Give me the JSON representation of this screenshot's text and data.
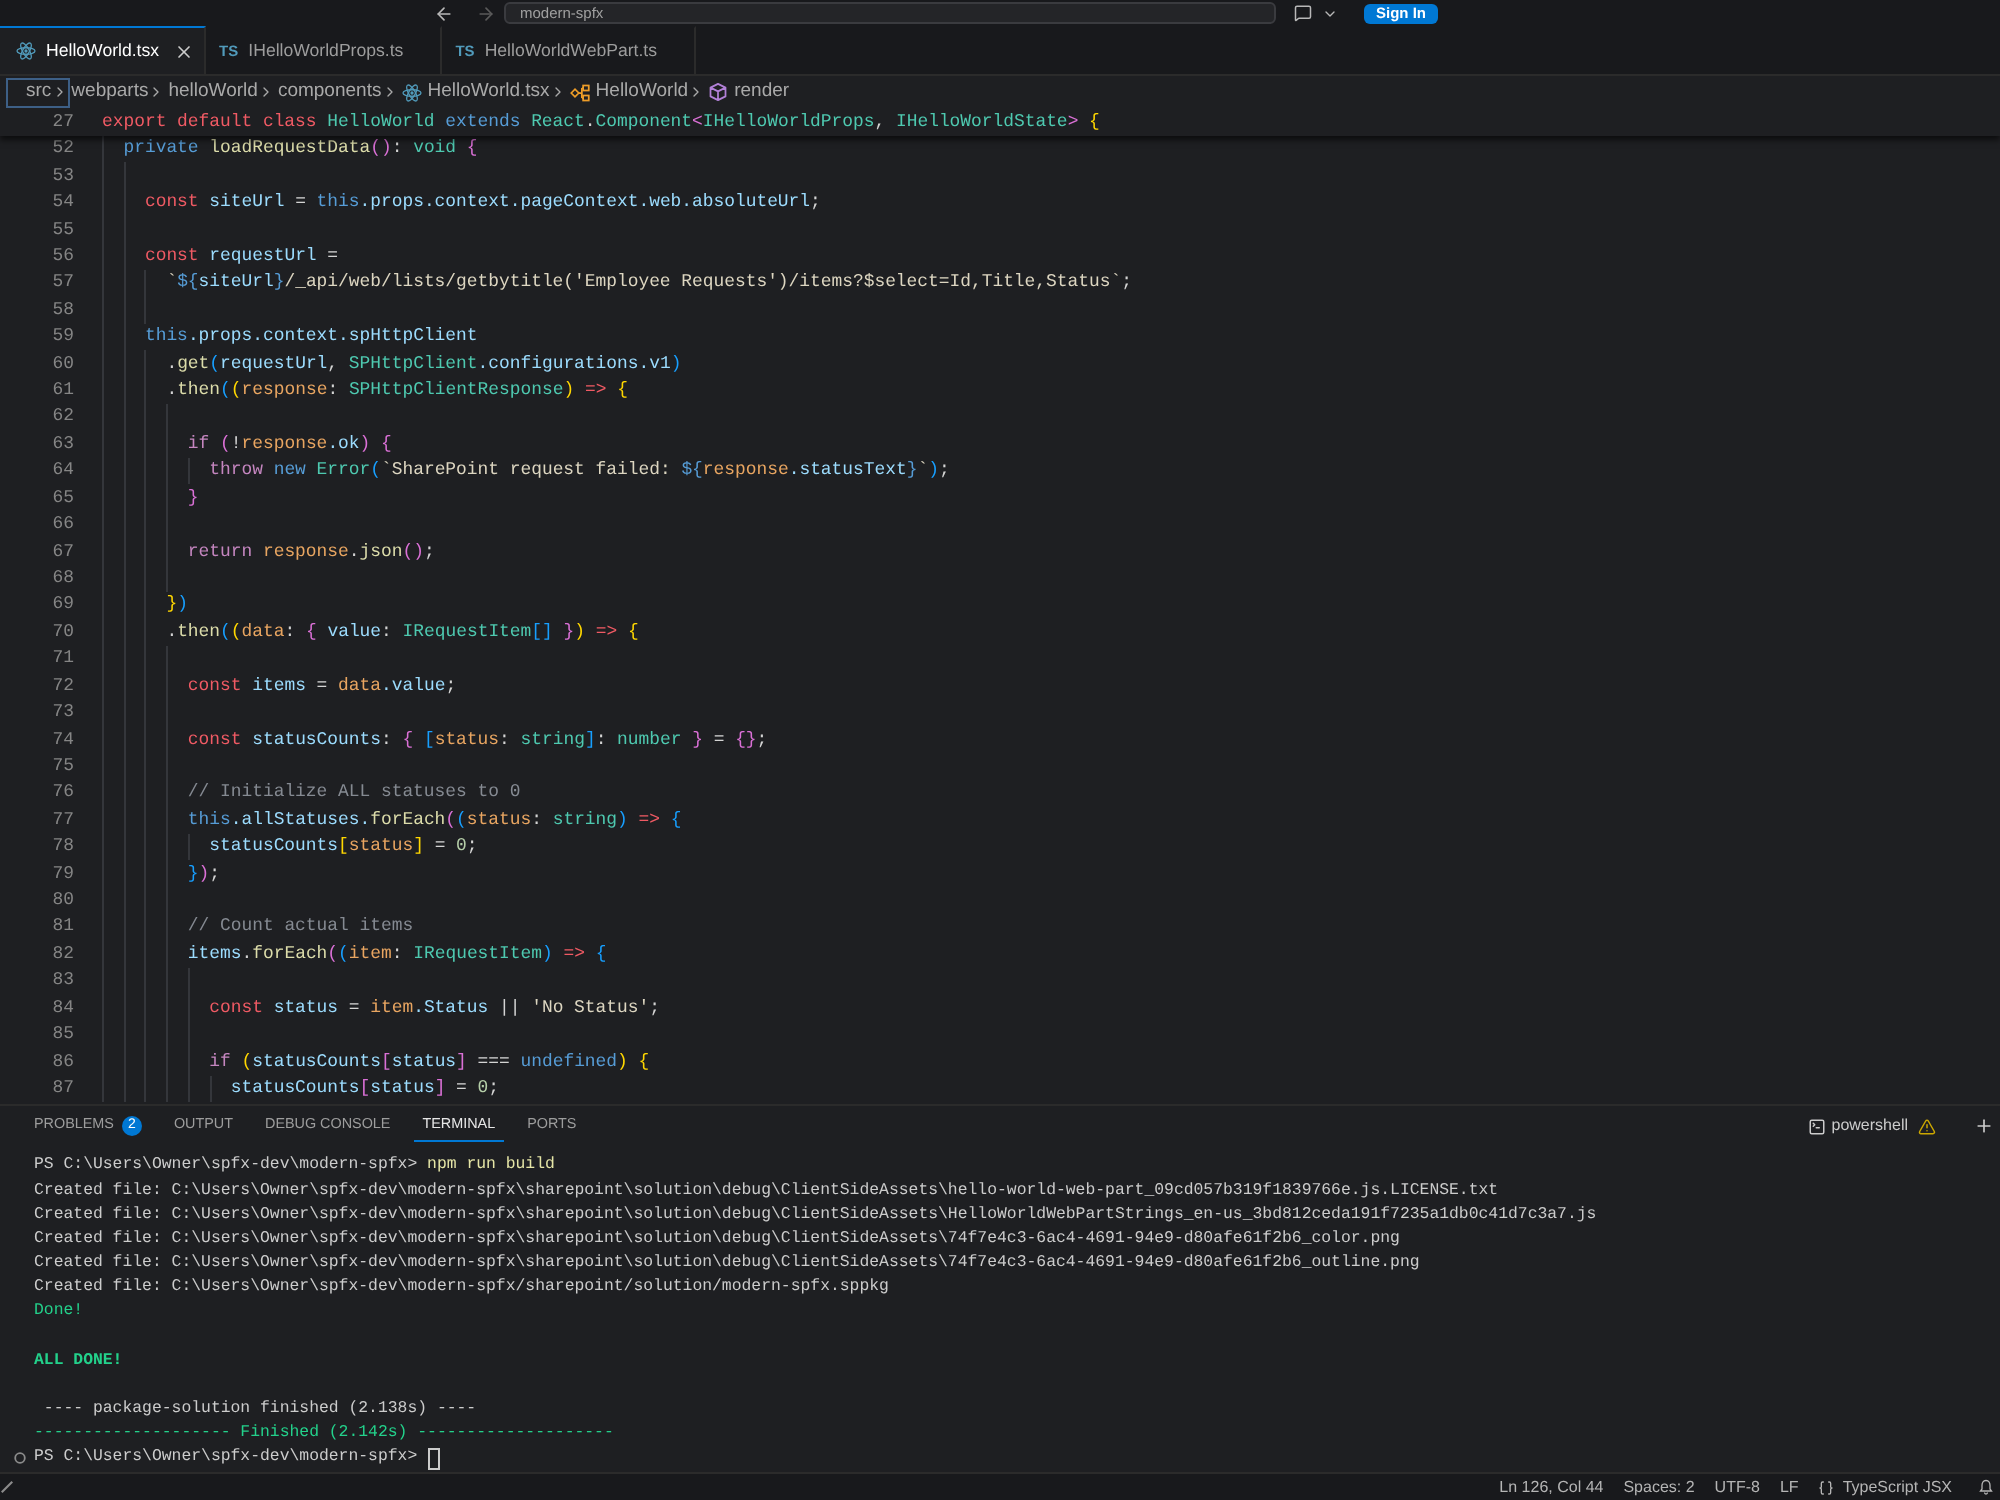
{
  "title_bar": {
    "back": {
      "disabled": false
    },
    "forward": {
      "disabled": true
    },
    "command_center": {
      "label": "modern-spfx"
    },
    "sign_in": {
      "label": "Sign In"
    }
  },
  "tabs": [
    {
      "label": "HelloWorld.tsx",
      "kind": "tsx",
      "selected": true
    },
    {
      "label": "IHelloWorldProps.ts",
      "kind": "ts",
      "file_badge": "TS",
      "selected": false
    },
    {
      "label": "HelloWorldWebPart.ts",
      "kind": "ts",
      "file_badge": "TS",
      "selected": false
    }
  ],
  "breadcrumbs": [
    {
      "label": "src",
      "kind": "folder",
      "focused": true
    },
    {
      "label": "webparts",
      "kind": "folder",
      "focused": false
    },
    {
      "label": "helloWorld",
      "kind": "folder",
      "focused": false
    },
    {
      "label": "components",
      "kind": "folder",
      "focused": false
    },
    {
      "label": "HelloWorld.tsx",
      "kind": "tsx_file",
      "focused": false
    },
    {
      "label": "HelloWorld",
      "kind": "class",
      "focused": false
    },
    {
      "label": "render",
      "kind": "method",
      "focused": false
    }
  ],
  "editor": {
    "sticky_line": {
      "number": "27",
      "tokens": [
        {
          "text": "export default class ",
          "kind": "decl"
        },
        {
          "text": "HelloWorld",
          "kind": "type"
        },
        {
          "text": " extends ",
          "kind": "kw"
        },
        {
          "text": "React",
          "kind": "type"
        },
        {
          "text": ".",
          "kind": "op"
        },
        {
          "text": "Component",
          "kind": "type"
        },
        {
          "text": "<",
          "kind": "b2"
        },
        {
          "text": "IHelloWorldProps",
          "kind": "type"
        },
        {
          "text": ", ",
          "kind": "op"
        },
        {
          "text": "IHelloWorldState",
          "kind": "type"
        },
        {
          "text": "> ",
          "kind": "b2"
        },
        {
          "text": "{",
          "kind": "b1"
        }
      ]
    },
    "lines": [
      {
        "number": "52",
        "tokens": [
          {
            "text": "  private ",
            "kind": "kw"
          },
          {
            "text": "loadRequestData",
            "kind": "fn"
          },
          {
            "text": "()",
            "kind": "b2"
          },
          {
            "text": ": ",
            "kind": "op"
          },
          {
            "text": "void ",
            "kind": "type"
          },
          {
            "text": "{",
            "kind": "b2"
          }
        ]
      },
      {
        "number": "53"
      },
      {
        "number": "54",
        "tokens": [
          {
            "text": "    const ",
            "kind": "decl"
          },
          {
            "text": "siteUrl",
            "kind": "var"
          },
          {
            "text": " = ",
            "kind": "op"
          },
          {
            "text": "this",
            "kind": "kw"
          },
          {
            "text": ".props.context.pageContext.web.absoluteUrl",
            "kind": "var"
          },
          {
            "text": ";",
            "kind": "op"
          }
        ]
      },
      {
        "number": "55"
      },
      {
        "number": "56",
        "tokens": [
          {
            "text": "    const ",
            "kind": "decl"
          },
          {
            "text": "requestUrl",
            "kind": "var"
          },
          {
            "text": " =",
            "kind": "op"
          }
        ]
      },
      {
        "number": "57",
        "tokens": [
          {
            "text": "      `",
            "kind": "str"
          },
          {
            "text": "${",
            "kind": "kw"
          },
          {
            "text": "siteUrl",
            "kind": "var"
          },
          {
            "text": "}",
            "kind": "kw"
          },
          {
            "text": "/_api/web/lists/getbytitle('Employee Requests')/items?$select=Id,Title,Status`",
            "kind": "str"
          },
          {
            "text": ";",
            "kind": "op"
          }
        ]
      },
      {
        "number": "58"
      },
      {
        "number": "59",
        "tokens": [
          {
            "text": "    this",
            "kind": "kw"
          },
          {
            "text": ".props.context.spHttpClient",
            "kind": "var"
          }
        ]
      },
      {
        "number": "60",
        "tokens": [
          {
            "text": "      .",
            "kind": "op"
          },
          {
            "text": "get",
            "kind": "fn"
          },
          {
            "text": "(",
            "kind": "b3"
          },
          {
            "text": "requestUrl",
            "kind": "var"
          },
          {
            "text": ", ",
            "kind": "op"
          },
          {
            "text": "SPHttpClient",
            "kind": "type"
          },
          {
            "text": ".configurations.v1",
            "kind": "var"
          },
          {
            "text": ")",
            "kind": "b3"
          }
        ]
      },
      {
        "number": "61",
        "tokens": [
          {
            "text": "      .",
            "kind": "op"
          },
          {
            "text": "then",
            "kind": "fn"
          },
          {
            "text": "(",
            "kind": "b3"
          },
          {
            "text": "(",
            "kind": "b1"
          },
          {
            "text": "response",
            "kind": "param"
          },
          {
            "text": ": ",
            "kind": "op"
          },
          {
            "text": "SPHttpClientResponse",
            "kind": "type"
          },
          {
            "text": ")",
            "kind": "b1"
          },
          {
            "text": " => ",
            "kind": "arrow"
          },
          {
            "text": "{",
            "kind": "b1"
          }
        ]
      },
      {
        "number": "62"
      },
      {
        "number": "63",
        "tokens": [
          {
            "text": "        if ",
            "kind": "ctl"
          },
          {
            "text": "(",
            "kind": "b2"
          },
          {
            "text": "!",
            "kind": "op"
          },
          {
            "text": "response",
            "kind": "param"
          },
          {
            "text": ".ok",
            "kind": "var"
          },
          {
            "text": ") {",
            "kind": "b2"
          }
        ]
      },
      {
        "number": "64",
        "tokens": [
          {
            "text": "          throw ",
            "kind": "ctl"
          },
          {
            "text": "new ",
            "kind": "kw"
          },
          {
            "text": "Error",
            "kind": "type"
          },
          {
            "text": "(",
            "kind": "b3"
          },
          {
            "text": "`SharePoint request failed: ",
            "kind": "str"
          },
          {
            "text": "${",
            "kind": "kw"
          },
          {
            "text": "response",
            "kind": "param"
          },
          {
            "text": ".statusText",
            "kind": "var"
          },
          {
            "text": "}",
            "kind": "kw"
          },
          {
            "text": "`",
            "kind": "str"
          },
          {
            "text": ")",
            "kind": "b3"
          },
          {
            "text": ";",
            "kind": "op"
          }
        ]
      },
      {
        "number": "65",
        "tokens": [
          {
            "text": "        }",
            "kind": "b2"
          }
        ]
      },
      {
        "number": "66"
      },
      {
        "number": "67",
        "tokens": [
          {
            "text": "        return ",
            "kind": "ctl"
          },
          {
            "text": "response",
            "kind": "param"
          },
          {
            "text": ".",
            "kind": "op"
          },
          {
            "text": "json",
            "kind": "fn"
          },
          {
            "text": "()",
            "kind": "b2"
          },
          {
            "text": ";",
            "kind": "op"
          }
        ]
      },
      {
        "number": "68"
      },
      {
        "number": "69",
        "tokens": [
          {
            "text": "      }",
            "kind": "b1"
          },
          {
            "text": ")",
            "kind": "b3"
          }
        ]
      },
      {
        "number": "70",
        "tokens": [
          {
            "text": "      .",
            "kind": "op"
          },
          {
            "text": "then",
            "kind": "fn"
          },
          {
            "text": "(",
            "kind": "b3"
          },
          {
            "text": "(",
            "kind": "b1"
          },
          {
            "text": "data",
            "kind": "param"
          },
          {
            "text": ": ",
            "kind": "op"
          },
          {
            "text": "{ ",
            "kind": "b2"
          },
          {
            "text": "value",
            "kind": "var"
          },
          {
            "text": ": ",
            "kind": "op"
          },
          {
            "text": "IRequestItem",
            "kind": "type"
          },
          {
            "text": "[]",
            "kind": "b3"
          },
          {
            "text": " }",
            "kind": "b2"
          },
          {
            "text": ")",
            "kind": "b1"
          },
          {
            "text": " => ",
            "kind": "arrow"
          },
          {
            "text": "{",
            "kind": "b1"
          }
        ]
      },
      {
        "number": "71"
      },
      {
        "number": "72",
        "tokens": [
          {
            "text": "        const ",
            "kind": "decl"
          },
          {
            "text": "items",
            "kind": "var"
          },
          {
            "text": " = ",
            "kind": "op"
          },
          {
            "text": "data",
            "kind": "param"
          },
          {
            "text": ".value",
            "kind": "var"
          },
          {
            "text": ";",
            "kind": "op"
          }
        ]
      },
      {
        "number": "73"
      },
      {
        "number": "74",
        "tokens": [
          {
            "text": "        const ",
            "kind": "decl"
          },
          {
            "text": "statusCounts",
            "kind": "var"
          },
          {
            "text": ": ",
            "kind": "op"
          },
          {
            "text": "{ ",
            "kind": "b2"
          },
          {
            "text": "[",
            "kind": "b3"
          },
          {
            "text": "status",
            "kind": "param"
          },
          {
            "text": ": ",
            "kind": "op"
          },
          {
            "text": "string",
            "kind": "type"
          },
          {
            "text": "]",
            "kind": "b3"
          },
          {
            "text": ": ",
            "kind": "op"
          },
          {
            "text": "number",
            "kind": "type"
          },
          {
            "text": " }",
            "kind": "b2"
          },
          {
            "text": " = ",
            "kind": "op"
          },
          {
            "text": "{}",
            "kind": "b2"
          },
          {
            "text": ";",
            "kind": "op"
          }
        ]
      },
      {
        "number": "75"
      },
      {
        "number": "76",
        "tokens": [
          {
            "text": "        // Initialize ALL statuses to 0",
            "kind": "cm"
          }
        ]
      },
      {
        "number": "77",
        "tokens": [
          {
            "text": "        this",
            "kind": "kw"
          },
          {
            "text": ".allStatuses.",
            "kind": "var"
          },
          {
            "text": "forEach",
            "kind": "fn"
          },
          {
            "text": "(",
            "kind": "b2"
          },
          {
            "text": "(",
            "kind": "b3"
          },
          {
            "text": "status",
            "kind": "param"
          },
          {
            "text": ": ",
            "kind": "op"
          },
          {
            "text": "string",
            "kind": "type"
          },
          {
            "text": ")",
            "kind": "b3"
          },
          {
            "text": " => ",
            "kind": "arrow"
          },
          {
            "text": "{",
            "kind": "b3"
          }
        ]
      },
      {
        "number": "78",
        "tokens": [
          {
            "text": "          statusCounts",
            "kind": "var"
          },
          {
            "text": "[",
            "kind": "b1"
          },
          {
            "text": "status",
            "kind": "param"
          },
          {
            "text": "]",
            "kind": "b1"
          },
          {
            "text": " = ",
            "kind": "op"
          },
          {
            "text": "0",
            "kind": "num"
          },
          {
            "text": ";",
            "kind": "op"
          }
        ]
      },
      {
        "number": "79",
        "tokens": [
          {
            "text": "        }",
            "kind": "b3"
          },
          {
            "text": ")",
            "kind": "b2"
          },
          {
            "text": ";",
            "kind": "op"
          }
        ]
      },
      {
        "number": "80"
      },
      {
        "number": "81",
        "tokens": [
          {
            "text": "        // Count actual items",
            "kind": "cm"
          }
        ]
      },
      {
        "number": "82",
        "tokens": [
          {
            "text": "        items",
            "kind": "var"
          },
          {
            "text": ".",
            "kind": "op"
          },
          {
            "text": "forEach",
            "kind": "fn"
          },
          {
            "text": "(",
            "kind": "b2"
          },
          {
            "text": "(",
            "kind": "b3"
          },
          {
            "text": "item",
            "kind": "param"
          },
          {
            "text": ": ",
            "kind": "op"
          },
          {
            "text": "IRequestItem",
            "kind": "type"
          },
          {
            "text": ")",
            "kind": "b3"
          },
          {
            "text": " => ",
            "kind": "arrow"
          },
          {
            "text": "{",
            "kind": "b3"
          }
        ]
      },
      {
        "number": "83"
      },
      {
        "number": "84",
        "tokens": [
          {
            "text": "          const ",
            "kind": "decl"
          },
          {
            "text": "status",
            "kind": "var"
          },
          {
            "text": " = ",
            "kind": "op"
          },
          {
            "text": "item",
            "kind": "param"
          },
          {
            "text": ".Status",
            "kind": "var"
          },
          {
            "text": " || ",
            "kind": "op"
          },
          {
            "text": "'No Status'",
            "kind": "str"
          },
          {
            "text": ";",
            "kind": "op"
          }
        ]
      },
      {
        "number": "85"
      },
      {
        "number": "86",
        "tokens": [
          {
            "text": "          if ",
            "kind": "ctl"
          },
          {
            "text": "(",
            "kind": "b1"
          },
          {
            "text": "statusCounts",
            "kind": "var"
          },
          {
            "text": "[",
            "kind": "b2"
          },
          {
            "text": "status",
            "kind": "var"
          },
          {
            "text": "]",
            "kind": "b2"
          },
          {
            "text": " === ",
            "kind": "op"
          },
          {
            "text": "undefined",
            "kind": "kw"
          },
          {
            "text": ") {",
            "kind": "b1"
          }
        ]
      },
      {
        "number": "87",
        "tokens": [
          {
            "text": "            statusCounts",
            "kind": "var"
          },
          {
            "text": "[",
            "kind": "b2"
          },
          {
            "text": "status",
            "kind": "var"
          },
          {
            "text": "]",
            "kind": "b2"
          },
          {
            "text": " = ",
            "kind": "op"
          },
          {
            "text": "0",
            "kind": "num"
          },
          {
            "text": ";",
            "kind": "op"
          }
        ]
      }
    ]
  },
  "panel": {
    "tabs": [
      {
        "label": "PROBLEMS",
        "badge": "2",
        "selected": false
      },
      {
        "label": "OUTPUT",
        "selected": false
      },
      {
        "label": "DEBUG CONSOLE",
        "selected": false
      },
      {
        "label": "TERMINAL",
        "selected": true
      },
      {
        "label": "PORTS",
        "selected": false
      }
    ],
    "terminal_name": "powershell",
    "terminal": {
      "lines": [
        {
          "segments": [
            {
              "text": "PS C:\\Users\\Owner\\spfx-dev\\modern-spfx>",
              "kind": "prompt"
            },
            {
              "text": " npm run build",
              "kind": "command"
            }
          ],
          "cursor": false,
          "decoration": false
        },
        {
          "segments": [
            {
              "text": "Created file: C:\\Users\\Owner\\spfx-dev\\modern-spfx\\sharepoint\\solution\\debug\\ClientSideAssets\\hello-world-web-part_09cd057b319f1839766e.js.LICENSE.txt",
              "kind": "text"
            }
          ],
          "cursor": false,
          "decoration": false
        },
        {
          "segments": [
            {
              "text": "Created file: C:\\Users\\Owner\\spfx-dev\\modern-spfx\\sharepoint\\solution\\debug\\ClientSideAssets\\HelloWorldWebPartStrings_en-us_3bd812ceda191f7235a1db0c41d7c3a7.js",
              "kind": "text"
            }
          ],
          "cursor": false,
          "decoration": false
        },
        {
          "segments": [
            {
              "text": "Created file: C:\\Users\\Owner\\spfx-dev\\modern-spfx\\sharepoint\\solution\\debug\\ClientSideAssets\\74f7e4c3-6ac4-4691-94e9-d80afe61f2b6_color.png",
              "kind": "text"
            }
          ],
          "cursor": false,
          "decoration": false
        },
        {
          "segments": [
            {
              "text": "Created file: C:\\Users\\Owner\\spfx-dev\\modern-spfx\\sharepoint\\solution\\debug\\ClientSideAssets\\74f7e4c3-6ac4-4691-94e9-d80afe61f2b6_outline.png",
              "kind": "text"
            }
          ],
          "cursor": false,
          "decoration": false
        },
        {
          "segments": [
            {
              "text": "Created file: C:\\Users\\Owner\\spfx-dev\\modern-spfx/sharepoint/solution/modern-spfx.sppkg",
              "kind": "text"
            }
          ],
          "cursor": false,
          "decoration": false
        },
        {
          "segments": [
            {
              "text": "Done!",
              "kind": "success"
            }
          ],
          "cursor": false,
          "decoration": false
        },
        {
          "cursor": false,
          "decoration": false
        },
        {
          "segments": [
            {
              "text": "ALL DONE!",
              "kind": "success_bold"
            }
          ],
          "cursor": false,
          "decoration": false
        },
        {
          "cursor": false,
          "decoration": false
        },
        {
          "segments": [
            {
              "text": " ---- package-solution finished (2.138s) ----",
              "kind": "text"
            }
          ],
          "cursor": false,
          "decoration": false
        },
        {
          "segments": [
            {
              "text": "-------------------- Finished (2.142s) --------------------",
              "kind": "success"
            }
          ],
          "cursor": false,
          "decoration": false
        },
        {
          "segments": [
            {
              "text": "PS C:\\Users\\Owner\\spfx-dev\\modern-spfx>",
              "kind": "prompt"
            }
          ],
          "cursor": true,
          "decoration": true
        }
      ]
    }
  },
  "status_bar": {
    "items": [
      {
        "label": "Ln 126, Col 44",
        "kind": "text"
      },
      {
        "label": "Spaces: 2",
        "kind": "text"
      },
      {
        "label": "UTF-8",
        "kind": "text"
      },
      {
        "label": "LF",
        "kind": "text"
      },
      {
        "label": "TypeScript JSX",
        "kind": "language"
      }
    ]
  }
}
